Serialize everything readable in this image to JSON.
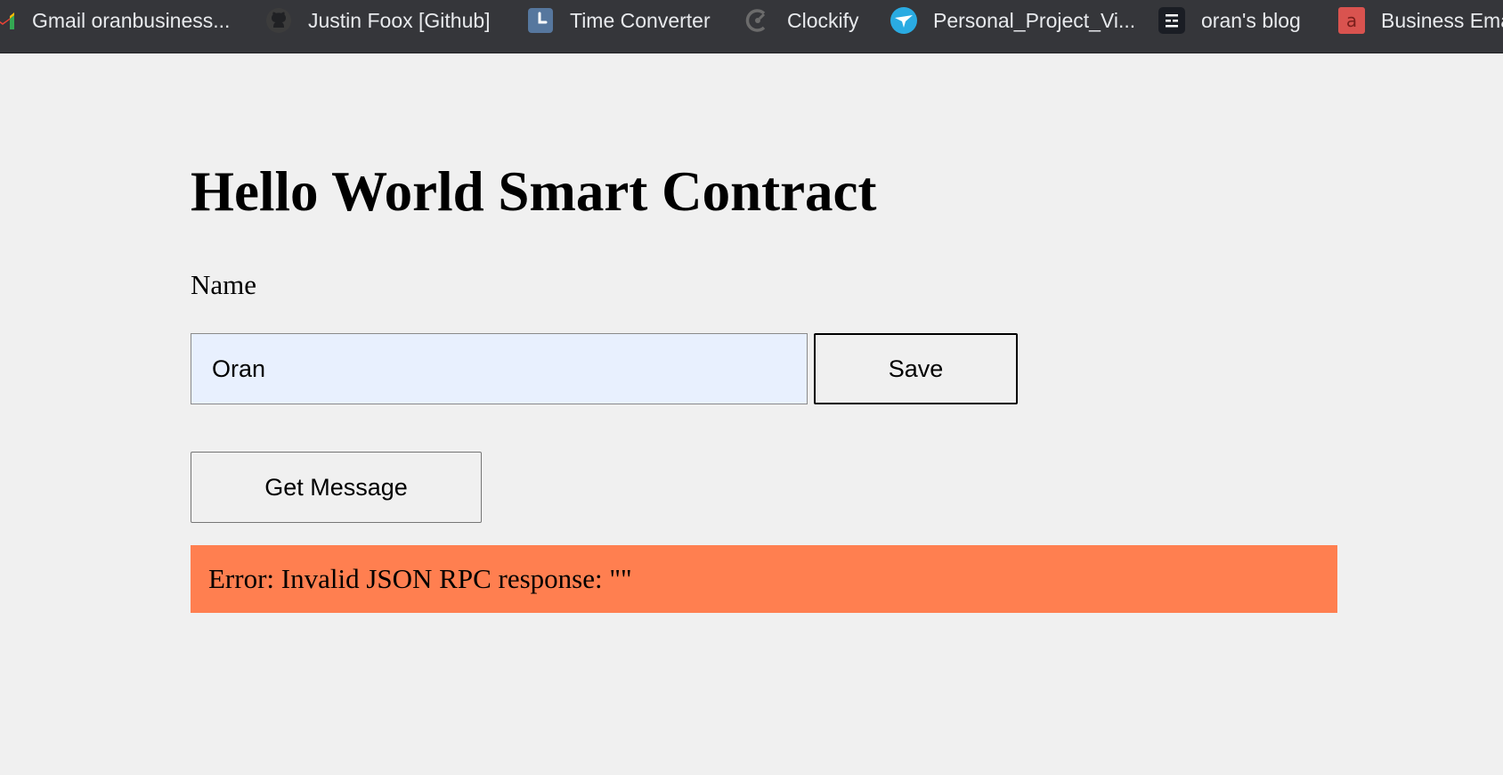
{
  "bookmarks_bar": {
    "items": [
      {
        "label": "Gmail oranbusiness...",
        "icon": "gmail-icon"
      },
      {
        "label": "Justin Foox [Github]",
        "icon": "github-icon"
      },
      {
        "label": "Time Converter",
        "icon": "clock-icon"
      },
      {
        "label": "Clockify",
        "icon": "clockify-icon"
      },
      {
        "label": "Personal_Project_Vi...",
        "icon": "bird-icon"
      },
      {
        "label": "oran's blog",
        "icon": "blog-icon"
      },
      {
        "label": "Business Email",
        "icon": "business-email-icon"
      }
    ]
  },
  "app": {
    "title": "Hello World Smart Contract",
    "name_label": "Name",
    "name_input_value": "Oran",
    "save_label": "Save",
    "get_message_label": "Get Message",
    "error_message": "Error: Invalid JSON RPC response: \"\""
  },
  "colors": {
    "page_background": "#f0f0f0",
    "bookmarks_bar_background": "#35363a",
    "error_banner": "#ff7f50",
    "input_autofill_background": "#e8f0fe"
  }
}
